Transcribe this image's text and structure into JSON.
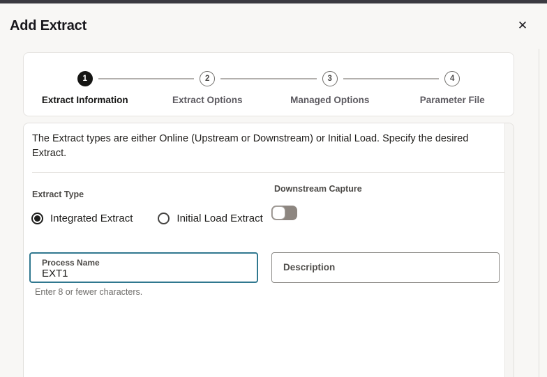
{
  "dialog": {
    "title": "Add Extract",
    "close_icon": "✕"
  },
  "stepper": {
    "steps": [
      {
        "number": "1",
        "label": "Extract Information",
        "state": "active"
      },
      {
        "number": "2",
        "label": "Extract Options",
        "state": "upcoming"
      },
      {
        "number": "3",
        "label": "Managed Options",
        "state": "upcoming"
      },
      {
        "number": "4",
        "label": "Parameter File",
        "state": "upcoming"
      }
    ]
  },
  "content": {
    "intro": "The Extract types are either Online (Upstream or Downstream) or Initial Load. Specify the desired Extract.",
    "extract_type": {
      "label": "Extract Type",
      "options": [
        {
          "label": "Integrated Extract",
          "selected": true
        },
        {
          "label": "Initial Load Extract",
          "selected": false
        }
      ]
    },
    "downstream_capture": {
      "label": "Downstream Capture",
      "enabled": false
    },
    "process_name": {
      "label": "Process Name",
      "value": "EXT1",
      "helper": "Enter 8 or fewer characters."
    },
    "description": {
      "label": "Description",
      "value": ""
    }
  },
  "colors": {
    "accent_focus": "#30788F",
    "topbar": "#3B3A41",
    "step_active": "#151513",
    "toggle_track_off": "#8D8680",
    "page_background": "#F8F7F5"
  }
}
